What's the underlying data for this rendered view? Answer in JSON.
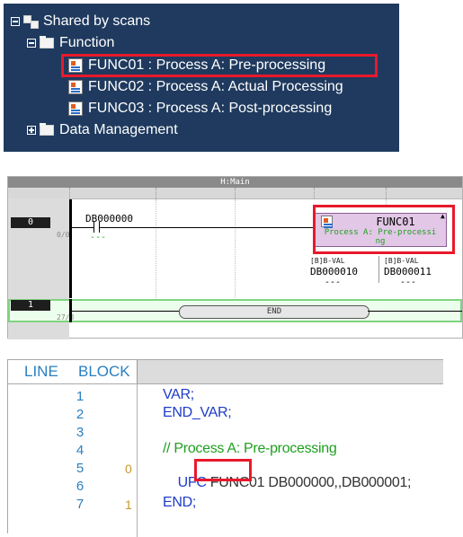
{
  "tree": {
    "root": "Shared by scans",
    "folder_function": "Function",
    "items": [
      "FUNC01 : Process A: Pre-processing",
      "FUNC02 : Process A: Actual Processing",
      "FUNC03 : Process A: Post-processing"
    ],
    "folder_data": "Data Management",
    "colors": {
      "background": "#1f3a5e",
      "highlight": "#e8192c"
    }
  },
  "ladder": {
    "header": "H:Main",
    "rungs": [
      {
        "number": "0",
        "step": "0/0"
      },
      {
        "number": "1",
        "step": "27/8"
      }
    ],
    "contact_label": "DB000000",
    "contact_value": "---",
    "fb_name": "FUNC01",
    "fb_desc_line1": "Process A: Pre-processi",
    "fb_desc_line2": "ng",
    "pins": [
      {
        "label": "[B]B-VAL",
        "device": "DB000010",
        "value": "---"
      },
      {
        "label": "[B]B-VAL",
        "device": "DB000011",
        "value": "---"
      }
    ],
    "end_label": "END"
  },
  "st_editor": {
    "header_line": "LINE",
    "header_block": "BLOCK",
    "lines": [
      {
        "num": "1",
        "block": "",
        "code": "VAR;"
      },
      {
        "num": "2",
        "block": "",
        "code": "END_VAR;"
      },
      {
        "num": "3",
        "block": "",
        "code": ""
      },
      {
        "num": "4",
        "block": "",
        "code": "// Process A: Pre-processing"
      },
      {
        "num": "5",
        "block": "0",
        "code_kw": "UFC",
        "code_fn": "FUNC01",
        "code_rest": "DB000000,,DB000001;"
      },
      {
        "num": "6",
        "block": "",
        "code": ""
      },
      {
        "num": "7",
        "block": "1",
        "code": "END;"
      }
    ]
  }
}
